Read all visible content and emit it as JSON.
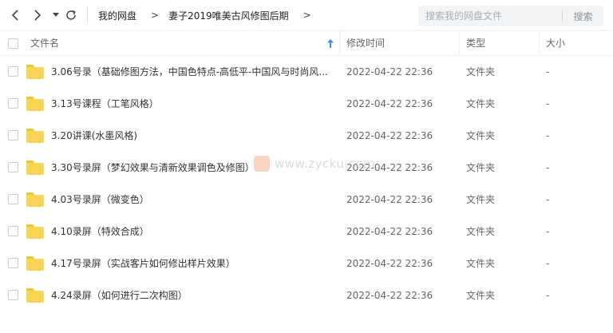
{
  "colors": {
    "folder_body": "#f8d558",
    "folder_back": "#f2c232",
    "icon": "#444444",
    "sort_arrow": "#3d8cf5",
    "watermark_logo": "#f6b08f"
  },
  "toolbar": {
    "back_icon": "chevron-left",
    "forward_icon": "chevron-right",
    "dropdown_icon": "triangle-down",
    "refresh_icon": "refresh"
  },
  "breadcrumb": [
    {
      "label": "我的网盘"
    },
    {
      "label": "妻子2019唯美古风修图后期"
    }
  ],
  "search": {
    "placeholder": "搜索我的网盘文件",
    "button": "搜索"
  },
  "table": {
    "columns": {
      "name": "文件名",
      "modified": "修改时间",
      "type": "类型",
      "size": "大小"
    },
    "sort": "ascending",
    "rows": [
      {
        "name": "3.06号录（基础修图方法，中国色特点-高低平-中国风与时尚风...",
        "modified": "2022-04-22 22:36",
        "type": "文件夹",
        "size": "-"
      },
      {
        "name": "3.13号课程（工笔风格）",
        "modified": "2022-04-22 22:36",
        "type": "文件夹",
        "size": "-"
      },
      {
        "name": "3.20讲课(水墨风格)",
        "modified": "2022-04-22 22:36",
        "type": "文件夹",
        "size": "-"
      },
      {
        "name": "3.30号录屏（梦幻效果与清新效果调色及修图）",
        "modified": "2022-04-22 22:36",
        "type": "文件夹",
        "size": "-"
      },
      {
        "name": "4.03号录屏（微变色）",
        "modified": "2022-04-22 22:36",
        "type": "文件夹",
        "size": "-"
      },
      {
        "name": "4.10录屏（特效合成）",
        "modified": "2022-04-22 22:36",
        "type": "文件夹",
        "size": "-"
      },
      {
        "name": "4.17号录屏（实战客片如何修出样片效果）",
        "modified": "2022-04-22 22:36",
        "type": "文件夹",
        "size": "-"
      },
      {
        "name": "4.24录屏（如何进行二次构图）",
        "modified": "2022-04-22 22:36",
        "type": "文件夹",
        "size": "-"
      }
    ]
  },
  "watermark": {
    "text": "www.zycku.com"
  }
}
